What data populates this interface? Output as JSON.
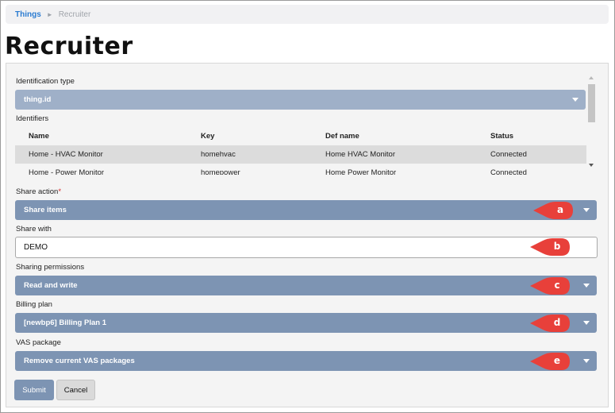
{
  "breadcrumb": {
    "root": "Things",
    "separator": "►",
    "current": "Recruiter"
  },
  "page_title": "Recruiter",
  "identification_type": {
    "label": "Identification type",
    "value": "thing.id"
  },
  "identifiers": {
    "label": "Identifiers",
    "columns": [
      "Name",
      "Key",
      "Def name",
      "Status"
    ],
    "rows": [
      {
        "name": "Home - HVAC Monitor",
        "key": "homehvac",
        "def_name": "Home HVAC Monitor",
        "status": "Connected",
        "selected": true
      },
      {
        "name": "Home - Power Monitor",
        "key": "homepower",
        "def_name": "Home Power Monitor",
        "status": "Connected",
        "selected": false
      }
    ]
  },
  "share_action": {
    "label": "Share action",
    "required_mark": "*",
    "value": "Share items",
    "callout": "a"
  },
  "share_with": {
    "label": "Share with",
    "value": "DEMO",
    "callout": "b"
  },
  "sharing_permissions": {
    "label": "Sharing permissions",
    "value": "Read and write",
    "callout": "c"
  },
  "billing_plan": {
    "label": "Billing plan",
    "value": "[newbp6] Billing Plan 1",
    "callout": "d"
  },
  "vas_package": {
    "label": "VAS package",
    "value": "Remove current VAS packages",
    "callout": "e"
  },
  "buttons": {
    "submit": "Submit",
    "cancel": "Cancel"
  },
  "colors": {
    "dropdown": "#7d94b3",
    "dropdown_light": "#9fb0c8",
    "callout": "#e8403a",
    "link": "#2a7bd1"
  }
}
